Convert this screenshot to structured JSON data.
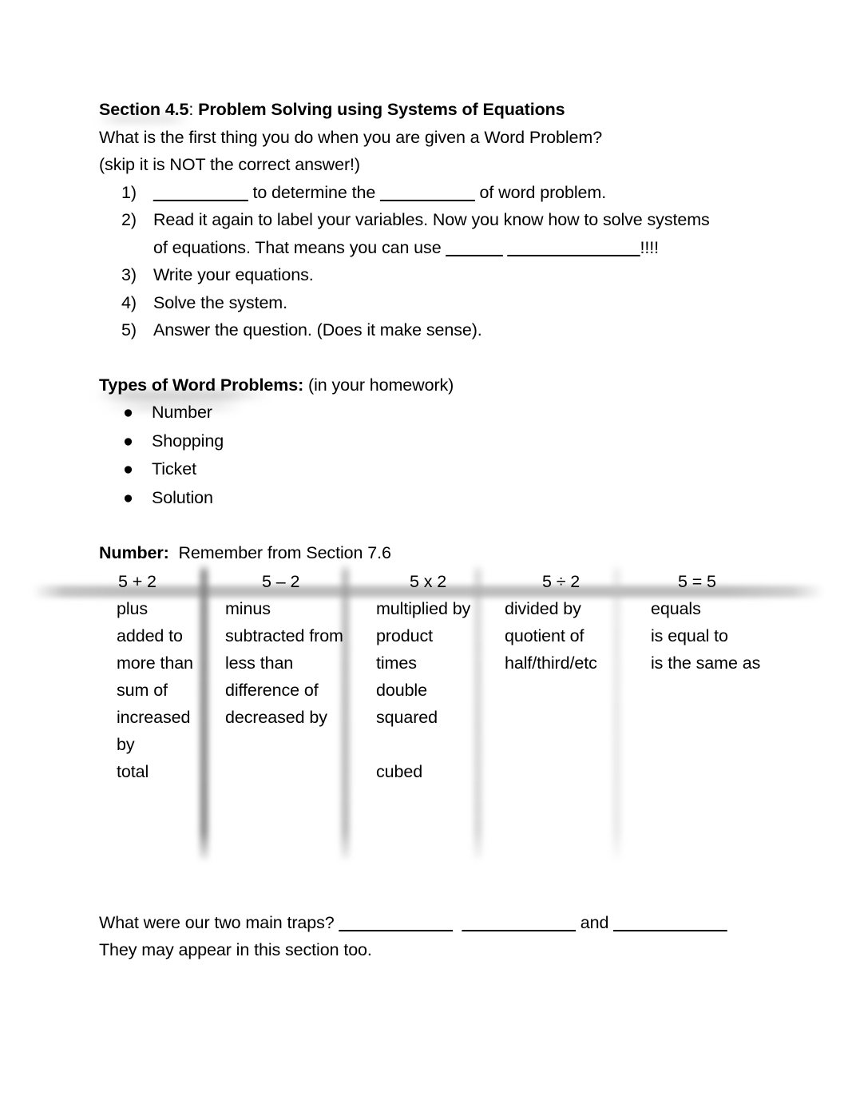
{
  "document": {
    "heading": {
      "section_label": "Section 4.5",
      "separator": ": ",
      "title": "Problem Solving using Systems of Equations"
    },
    "intro": {
      "question": "What is the first thing you do when you are given a Word Problem?",
      "note": "(skip it is NOT the correct answer!)"
    },
    "steps": [
      {
        "marker": "1)",
        "parts": {
          "blank_a": "__________",
          "mid": " to determine the ",
          "blank_b": "__________",
          "tail": " of word problem."
        }
      },
      {
        "marker": "2)",
        "parts": {
          "line1": "Read it again to label your variables. Now you know how to solve systems",
          "line2_pre": "of equations.  That means you can use ",
          "blank_a": "______",
          "gap": "  ",
          "blank_b": "______________",
          "line2_post": "!!!!"
        }
      },
      {
        "marker": "3)",
        "parts": {
          "text": "Write your equations."
        }
      },
      {
        "marker": "4)",
        "parts": {
          "text": "Solve the system."
        }
      },
      {
        "marker": "5)",
        "parts": {
          "text": "Answer the question.  (Does it make sense)."
        }
      }
    ],
    "types_section": {
      "heading_bold": "Types of Word Problems:",
      "heading_normal": " (in your homework)",
      "bullet_glyph": "●",
      "items": [
        "Number",
        "Shopping",
        "Ticket",
        "Solution"
      ]
    },
    "number_section": {
      "heading_bold": "Number:",
      "heading_normal": "  Remember from Section 7.6"
    },
    "footer": {
      "traps_pre": "What were our two main traps? ",
      "traps_blank_a": "____________",
      "traps_gap": "  ",
      "traps_blank_b": "____________",
      "traps_and": " and ",
      "traps_blank_c": "____________",
      "traps_followup": "They may appear in this section too."
    }
  },
  "chart_data": {
    "type": "table",
    "title": "Number: Remember from Section 7.6",
    "columns": [
      {
        "expression": "5 + 2",
        "words": [
          "plus",
          "added to",
          "more than",
          "sum of",
          "increased by",
          "total"
        ]
      },
      {
        "expression": "5 – 2",
        "words": [
          "minus",
          "subtracted from",
          "less than",
          "difference of",
          "decreased by"
        ]
      },
      {
        "expression": "5 x 2",
        "words": [
          "multiplied by",
          "product",
          "times",
          "double",
          "squared",
          "cubed"
        ]
      },
      {
        "expression": "5 ÷ 2",
        "words": [
          "divided by",
          "quotient of",
          "half/third/etc"
        ]
      },
      {
        "expression": "5 = 5",
        "words": [
          "equals",
          "is equal to",
          "is the same as"
        ]
      }
    ],
    "grid": "ghost-scan-lines",
    "legend": "none"
  }
}
